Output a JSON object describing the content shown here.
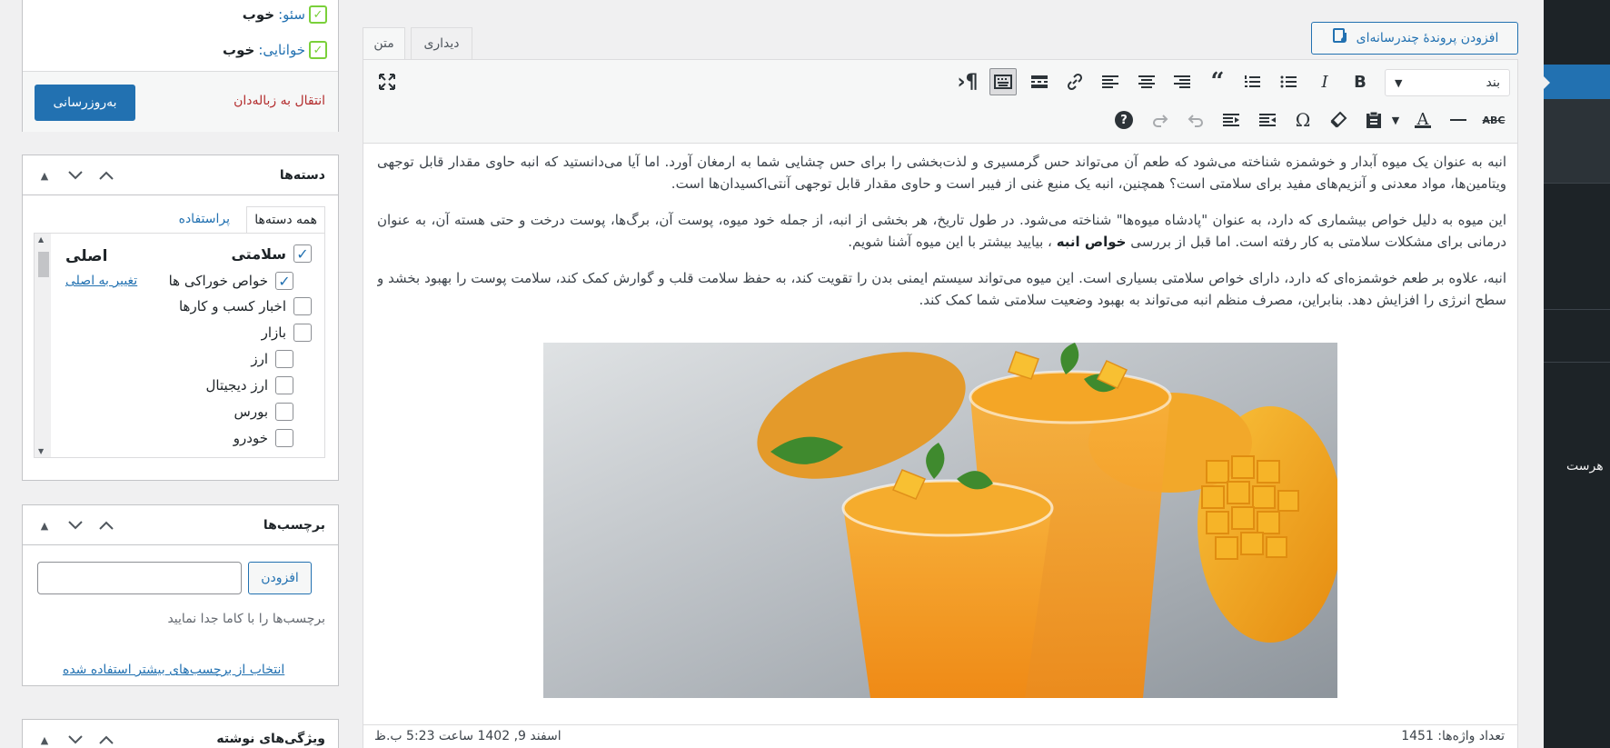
{
  "admin_menu": {
    "partial_label": "هرست"
  },
  "editor": {
    "add_media_label": "افزودن پروندهٔ چندرسانه‌ای",
    "tabs": {
      "visual": "دیداری",
      "text": "متن"
    },
    "format_select_value": "بند",
    "paragraphs": [
      "انبه به عنوان یک میوه آبدار و خوشمزه شناخته می‌شود که طعم آن می‌تواند حس گرمسیری و لذت‌بخشی را برای حس چشایی شما به ارمغان آورد. اما آیا می‌دانستید که انبه حاوی مقدار قابل توجهی ویتامین‌ها، مواد معدنی و آنزیم‌های مفید برای سلامتی است؟ همچنین، انبه یک منبع غنی از فیبر است و حاوی مقدار قابل توجهی آنتی‌اکسیدان‌ها است.",
      "این میوه به دلیل خواص بیشماری که دارد، به عنوان \"پادشاه میوه‌ها\" شناخته می‌شود. در طول تاریخ، هر بخشی از انبه، از جمله خود میوه، پوست آن، برگ‌ها، پوست درخت و حتی هسته آن، به عنوان درمانی برای مشکلات سلامتی به کار رفته است. اما قبل از بررسی",
      "انبه، علاوه بر طعم خوشمزه‌ای که دارد، دارای خواص سلامتی بسیاری است. این میوه می‌تواند سیستم ایمنی بدن را تقویت کند، به حفظ سلامت قلب و گوارش کمک کند، سلامت پوست را بهبود بخشد و سطح انرژی را افزایش دهد. بنابراین، مصرف منظم انبه می‌تواند به بهبود وضعیت سلامتی شما کمک کند."
    ],
    "p2_bold": "خواص انبه",
    "p2_tail": "، بیایید بیشتر با این میوه آشنا شویم.",
    "word_count": "تعداد واژه‌ها: 1451",
    "last_saved": "اسفند 9, 1402 ساعت 5:23 ب.ظ"
  },
  "publish": {
    "seo_label": "سئو:",
    "seo_value": "خوب",
    "readability_label": "خوانایی:",
    "readability_value": "خوب",
    "trash_label": "انتقال به زباله‌دان",
    "update_label": "به‌روزرسانی"
  },
  "categories": {
    "title": "دسته‌ها",
    "tab_all": "همه دسته‌ها",
    "tab_popular": "پراستفاده",
    "primary_label": "اصلی",
    "make_primary_label": "تغییر به اصلی",
    "items": [
      {
        "label": "سلامتی",
        "checked": true
      },
      {
        "label": "خواص خوراکی ها",
        "checked": true
      },
      {
        "label": "اخبار کسب و کارها",
        "checked": false
      },
      {
        "label": "بازار",
        "checked": false
      },
      {
        "label": "ارز",
        "checked": false
      },
      {
        "label": "ارز دیجیتال",
        "checked": false
      },
      {
        "label": "بورس",
        "checked": false
      },
      {
        "label": "خودرو",
        "checked": false
      }
    ]
  },
  "tags": {
    "title": "برچسب‌ها",
    "add_label": "افزودن",
    "input_value": "",
    "hint": "برچسب‌ها را با کاما جدا نمایید",
    "popular_link": "انتخاب از برچسب‌های بیشتر استفاده شده"
  },
  "post_props": {
    "title": "ویژگی‌های نوشته"
  },
  "colors": {
    "accent": "#2271b1",
    "admin_bar": "#1d2327",
    "danger": "#b32d2e",
    "yoast_good": "#7ad03a"
  }
}
